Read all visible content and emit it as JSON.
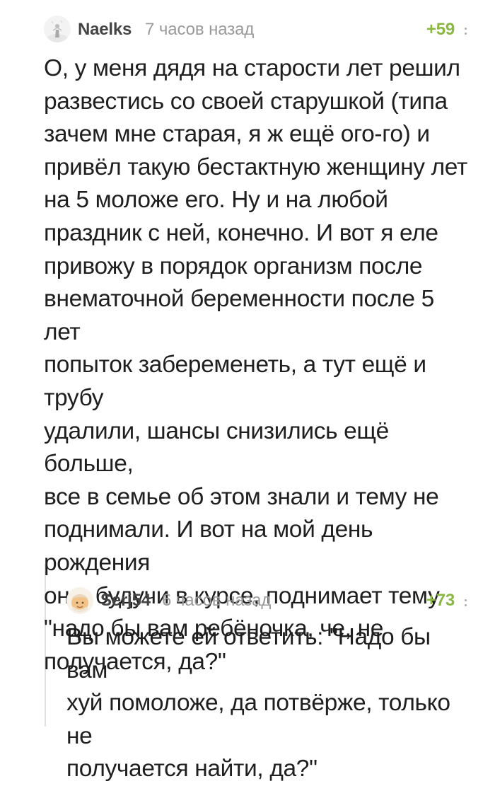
{
  "comments": [
    {
      "username": "Naelks",
      "timestamp": "7 часов назад",
      "rating": "+59",
      "avatar_icon": "avatar-statue-icon",
      "text": "О, у меня дядя на старости лет решил\nразвестись со своей старушкой (типа\nзачем мне старая, я ж ещё ого-го) и\nпривёл такую бестактную женщину лет\nна 5 моложе его. Ну и на любой\nпраздник с ней, конечно. И вот я еле\nпривожу в порядок организм после\nвнематочной беременности после 5 лет\nпопыток забеременеть, а тут ещё и трубу\nудалили, шансы снизились ещё больше,\nвсе в семье об этом знали и тему не\nподнимали. И вот на мой день рождения\nона, будучи в курсе, поднимает тему\n\"надо бы вам ребёночка, че, не\nполучается, да?\""
    },
    {
      "username": "Serj54",
      "timestamp": "6 часов назад",
      "rating": "+73",
      "avatar_icon": "avatar-baby-icon",
      "text": "Вы можете ей ответить: \"Надо бы вам\nхуй помоложе, да потвёрже, только не\nполучается найти, да?\""
    }
  ],
  "colors": {
    "username": "#444444",
    "timestamp": "#9a9a9a",
    "rating": "#8ab842",
    "text": "#1f1f1f",
    "thread_line": "#e1e1e1",
    "more_dots": "#aaaaaa"
  },
  "icons": {
    "more": "vertical-more-icon"
  }
}
